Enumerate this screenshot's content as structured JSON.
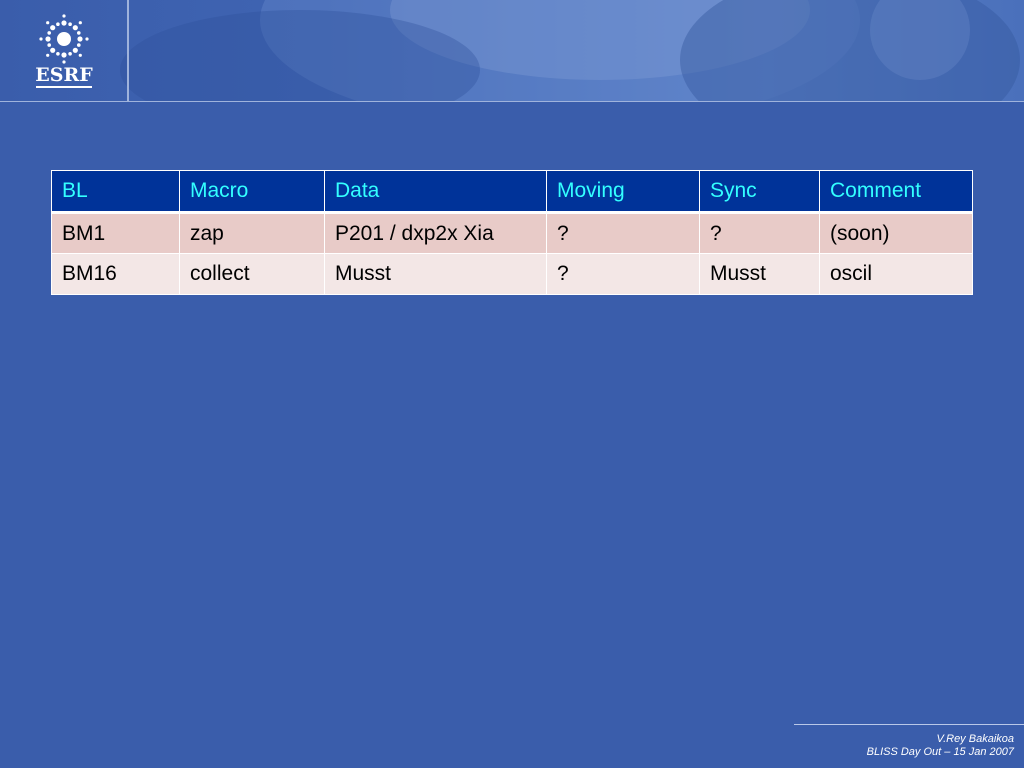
{
  "brand": {
    "logo_text": "ESRF",
    "colors": {
      "background": "#3a5dab",
      "header_fill": "#003399",
      "header_text": "#33ffff",
      "row_odd": "#e8cbc8",
      "row_even": "#f3e7e6"
    }
  },
  "table": {
    "headers": [
      "BL",
      "Macro",
      "Data",
      "Moving",
      "Sync",
      "Comment"
    ],
    "rows": [
      [
        "BM1",
        "zap",
        "P201 / dxp2x Xia",
        "?",
        "?",
        "(soon)"
      ],
      [
        "BM16",
        "collect",
        "Musst",
        "?",
        "Musst",
        "oscil"
      ]
    ]
  },
  "footer": {
    "author": "V.Rey Bakaikoa",
    "event": "BLISS Day Out – 15 Jan 2007"
  }
}
